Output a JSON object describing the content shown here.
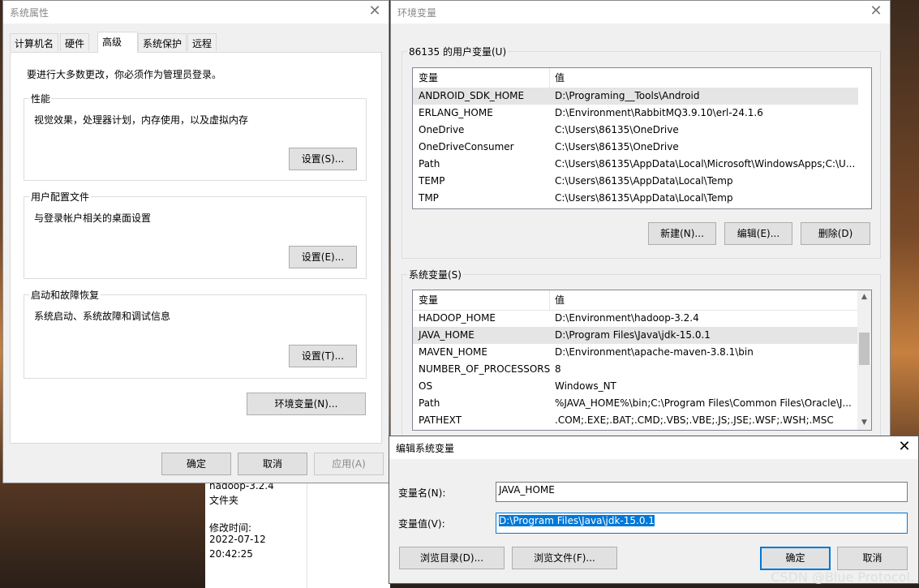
{
  "sys_props": {
    "title": "系统属性",
    "tabs": [
      "计算机名",
      "硬件",
      "高级",
      "系统保护",
      "远程"
    ],
    "admin_note": "要进行大多数更改，你必须作为管理员登录。",
    "perf": {
      "label": "性能",
      "desc": "视觉效果，处理器计划，内存使用，以及虚拟内存",
      "button": "设置(S)..."
    },
    "profile": {
      "label": "用户配置文件",
      "desc": "与登录帐户相关的桌面设置",
      "button": "设置(E)..."
    },
    "startup": {
      "label": "启动和故障恢复",
      "desc": "系统启动、系统故障和调试信息",
      "button": "设置(T)..."
    },
    "env_button": "环境变量(N)...",
    "ok": "确定",
    "cancel": "取消",
    "apply": "应用(A)"
  },
  "env_vars": {
    "title": "环境变量",
    "user_group": "86135 的用户变量(U)",
    "col_var": "变量",
    "col_val": "值",
    "user_rows": [
      {
        "name": "ANDROID_SDK_HOME",
        "value": "D:\\Programing__Tools\\Android"
      },
      {
        "name": "ERLANG_HOME",
        "value": "D:\\Environment\\RabbitMQ3.9.10\\erl-24.1.6"
      },
      {
        "name": "OneDrive",
        "value": "C:\\Users\\86135\\OneDrive"
      },
      {
        "name": "OneDriveConsumer",
        "value": "C:\\Users\\86135\\OneDrive"
      },
      {
        "name": "Path",
        "value": "C:\\Users\\86135\\AppData\\Local\\Microsoft\\WindowsApps;C:\\U..."
      },
      {
        "name": "TEMP",
        "value": "C:\\Users\\86135\\AppData\\Local\\Temp"
      },
      {
        "name": "TMP",
        "value": "C:\\Users\\86135\\AppData\\Local\\Temp"
      }
    ],
    "new": "新建(N)...",
    "edit": "编辑(E)...",
    "delete": "删除(D)",
    "sys_group": "系统变量(S)",
    "sys_rows": [
      {
        "name": "HADOOP_HOME",
        "value": "D:\\Environment\\hadoop-3.2.4"
      },
      {
        "name": "JAVA_HOME",
        "value": "D:\\Program Files\\Java\\jdk-15.0.1"
      },
      {
        "name": "MAVEN_HOME",
        "value": "D:\\Environment\\apache-maven-3.8.1\\bin"
      },
      {
        "name": "NUMBER_OF_PROCESSORS",
        "value": "8"
      },
      {
        "name": "OS",
        "value": "Windows_NT"
      },
      {
        "name": "Path",
        "value": "%JAVA_HOME%\\bin;C:\\Program Files\\Common Files\\Oracle\\J..."
      },
      {
        "name": "PATHEXT",
        "value": ".COM;.EXE;.BAT;.CMD;.VBS;.VBE;.JS;.JSE;.WSF;.WSH;.MSC"
      }
    ]
  },
  "explorer_fragment": {
    "name": "hadoop-3.2.4",
    "type": "文件夹",
    "modified_label": "修改时间:",
    "date": "2022-07-12",
    "time": "20:42:25"
  },
  "edit_dialog": {
    "title": "编辑系统变量",
    "name_label": "变量名(N):",
    "name_value": "JAVA_HOME",
    "value_label": "变量值(V):",
    "value_value": "D:\\Program Files\\Java\\jdk-15.0.1",
    "browse_dir": "浏览目录(D)...",
    "browse_file": "浏览文件(F)...",
    "ok": "确定",
    "cancel": "取消"
  },
  "watermark": "CSDN @Blue Protocol."
}
